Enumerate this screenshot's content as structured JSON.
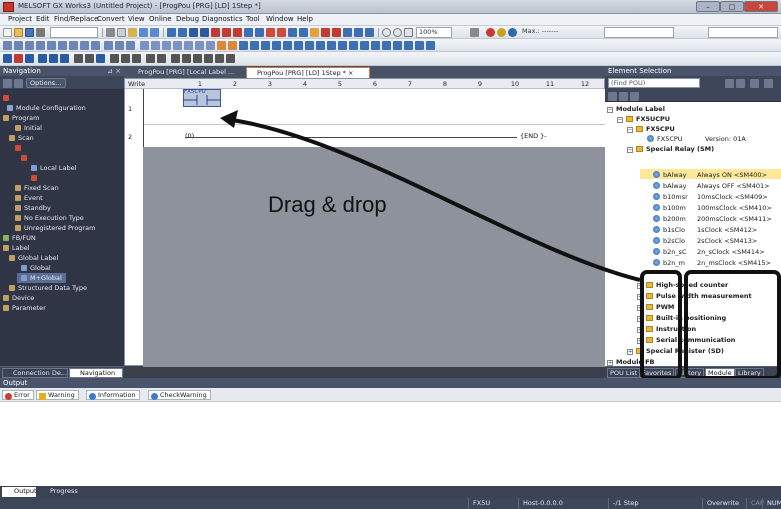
{
  "window": {
    "title": "MELSOFT GX Works3 (Untitled Project) - [ProgPou [PRG] [LD] 1Step *]",
    "min": "–",
    "max": "□",
    "close": "✕"
  },
  "menu": [
    "Project",
    "Edit",
    "Find/Replace",
    "Convert",
    "View",
    "Online",
    "Debug",
    "Diagnostics",
    "Tool",
    "Window",
    "Help"
  ],
  "toolbar": {
    "zoom": "100%",
    "max_label": "Max.: -------"
  },
  "navigation": {
    "header": "Navigation",
    "options": "Options...",
    "tree": [
      {
        "label": "",
        "indent": 0,
        "style": "red"
      },
      {
        "label": "Module Configuration",
        "indent": 1
      },
      {
        "label": "Program",
        "indent": 0
      },
      {
        "label": "Initial",
        "indent": 2
      },
      {
        "label": "Scan",
        "indent": 1
      },
      {
        "label": "",
        "indent": 2,
        "style": "red"
      },
      {
        "label": "",
        "indent": 3,
        "style": "red"
      },
      {
        "label": "Local Label",
        "indent": 4
      },
      {
        "label": "",
        "indent": 4,
        "style": "red"
      },
      {
        "label": "Fixed Scan",
        "indent": 2
      },
      {
        "label": "Event",
        "indent": 2
      },
      {
        "label": "Standby",
        "indent": 2
      },
      {
        "label": "No Execution Type",
        "indent": 2
      },
      {
        "label": "Unregistered Program",
        "indent": 2
      },
      {
        "label": "FB/FUN",
        "indent": 0
      },
      {
        "label": "Label",
        "indent": 0
      },
      {
        "label": "Global Label",
        "indent": 1
      },
      {
        "label": "Global",
        "indent": 3
      },
      {
        "label": "M+Global",
        "indent": 3,
        "style": "sel"
      },
      {
        "label": "Structured Data Type",
        "indent": 1
      },
      {
        "label": "Device",
        "indent": 0
      },
      {
        "label": "Parameter",
        "indent": 0
      }
    ],
    "tabs": [
      "Connection De...",
      "Navigation"
    ]
  },
  "doc_tabs": [
    "ProgPou [PRG] [Local Label ...",
    "ProgPou [PRG] [LD] 1Step *"
  ],
  "doc_tab_close": "×",
  "ladder": {
    "mode": "Write",
    "columns": [
      "1",
      "2",
      "3",
      "4",
      "5",
      "6",
      "7",
      "8",
      "9",
      "10",
      "11",
      "12"
    ],
    "rows": [
      "1",
      "2"
    ],
    "contact_label": "FX5CPU",
    "rung2_step": "(0)",
    "end_label": "{END }-"
  },
  "annotation": "Drag & drop",
  "element_selection": {
    "header": "Element Selection",
    "find_placeholder": "(Find POU)",
    "tree": [
      {
        "label": "Module Label",
        "indent": 0,
        "bold": true,
        "icon": "none"
      },
      {
        "label": "FX5UCPU",
        "indent": 1,
        "bold": true,
        "icon": "folder"
      },
      {
        "label": "FX5CPU",
        "indent": 2,
        "bold": true,
        "icon": "folder"
      },
      {
        "label": "FX5CPU",
        "indent": 3,
        "icon": "device",
        "extra": "Version: 01A"
      },
      {
        "label": "Special Relay (SM)",
        "indent": 2,
        "bold": true,
        "icon": "folder"
      },
      {
        "label": "bAlway",
        "indent": 3,
        "icon": "device",
        "extra": "Always ON <SM400>",
        "hl": true
      },
      {
        "label": "bAlway",
        "indent": 3,
        "icon": "device",
        "extra": "Always OFF <SM401>"
      },
      {
        "label": "b10msr",
        "indent": 3,
        "icon": "device",
        "extra": "10msClock <SM409>"
      },
      {
        "label": "b100m",
        "indent": 3,
        "icon": "device",
        "extra": "100msClock <SM410>"
      },
      {
        "label": "b200m",
        "indent": 3,
        "icon": "device",
        "extra": "200msClock <SM411>"
      },
      {
        "label": "b1sClo",
        "indent": 3,
        "icon": "device",
        "extra": "1sClock <SM412>"
      },
      {
        "label": "b2sClo",
        "indent": 3,
        "icon": "device",
        "extra": "2sClock <SM413>"
      },
      {
        "label": "b2n_sC",
        "indent": 3,
        "icon": "device",
        "extra": "2n_sClock <SM414>"
      },
      {
        "label": "b2n_m",
        "indent": 3,
        "icon": "device",
        "extra": "2n_msClock <SM415>"
      },
      {
        "label": "High-speed counter",
        "indent": 2,
        "bold": true,
        "icon": "folder"
      },
      {
        "label": "Pulse width measurement",
        "indent": 2,
        "bold": true,
        "icon": "folder"
      },
      {
        "label": "PWM",
        "indent": 2,
        "bold": true,
        "icon": "folder"
      },
      {
        "label": "Built-in positioning",
        "indent": 2,
        "bold": true,
        "icon": "folder"
      },
      {
        "label": "Instruction",
        "indent": 2,
        "bold": true,
        "icon": "folder"
      },
      {
        "label": "Serial communication",
        "indent": 2,
        "bold": true,
        "icon": "folder"
      },
      {
        "label": "Special Register (SD)",
        "indent": 1,
        "bold": true,
        "icon": "folder"
      },
      {
        "label": "Module FB",
        "indent": 0,
        "bold": true,
        "icon": "none"
      }
    ],
    "tabs": [
      "POU List",
      "Favorites",
      "History",
      "Module",
      "Library"
    ]
  },
  "output": {
    "header": "Output",
    "filters": [
      "Error",
      "Warning",
      "Information",
      "CheckWarning"
    ],
    "tabs": [
      "Output",
      "Progress"
    ]
  },
  "status": {
    "model": "FX5U",
    "host": "Host-0.0.0.0",
    "step": "-/1 Step",
    "mode": "Overwrite",
    "caps": "CAP",
    "num": "NUM"
  },
  "colors": {
    "accent": "#d7743c",
    "panel_dark": "#2f3545",
    "selection": "#b9c5d8"
  }
}
